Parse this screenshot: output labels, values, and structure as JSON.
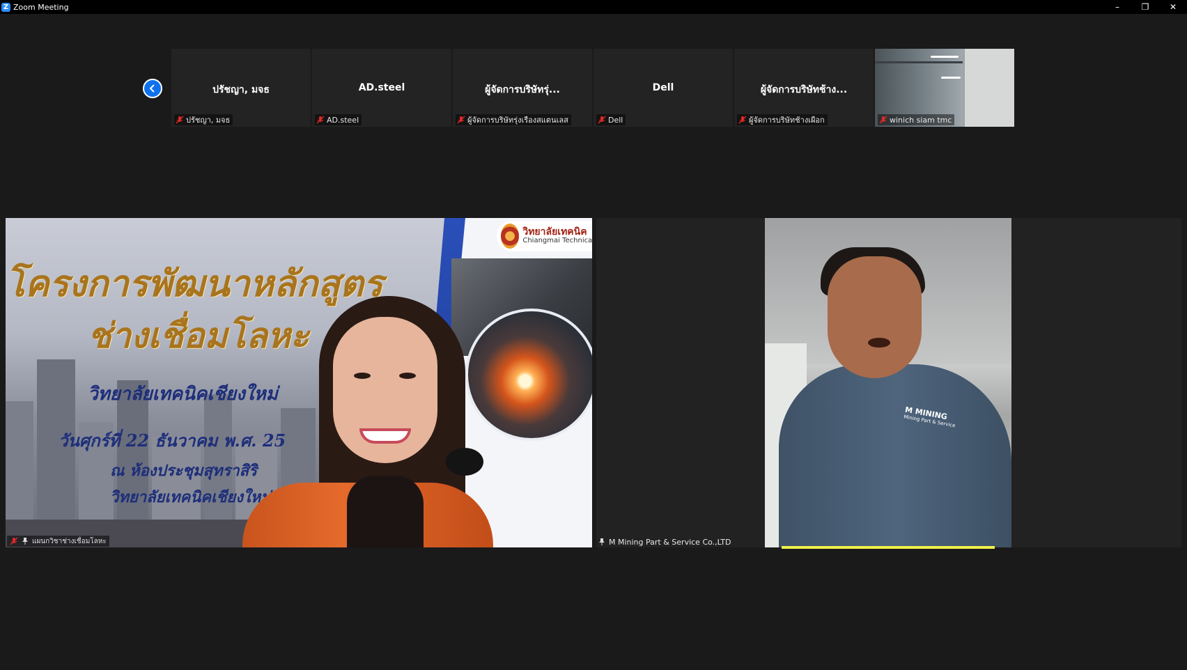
{
  "window": {
    "title": "Zoom Meeting",
    "logo_letter": "Z",
    "minimize": "–",
    "restore": "❐",
    "close": "✕"
  },
  "gallery": {
    "tiles": [
      {
        "center_name": "ปรัชญา, มจธ",
        "label": "ปรัชญา, มจธ"
      },
      {
        "center_name": "AD.steel",
        "label": "AD.steel"
      },
      {
        "center_name": "ผู้จัดการบริษัทรุ่...",
        "label": "ผู้จัดการบริษัทรุ่งเรืองสแตนเลส"
      },
      {
        "center_name": "Dell",
        "label": "Dell"
      },
      {
        "center_name": "ผู้จัดการบริษัทช้าง...",
        "label": "ผู้จัดการบริษัทช้างเผือก"
      },
      {
        "center_name": "",
        "label": "winich siam tmc"
      }
    ]
  },
  "main_video": {
    "label": "แผนกวิชาช่างเชื่อมโลหะ",
    "slide": {
      "logo_th": "วิทยาลัยเทคนิค",
      "logo_en": "Chiangmai Technical",
      "title_line1": "โครงการพัฒนาหลักสูตร",
      "title_line2": "ช่างเชื่อมโลหะ",
      "college": "วิทยาลัยเทคนิคเชียงใหม่",
      "date": "วันศุกร์ที่ 22 ธันวาคม พ.ศ. 25",
      "venue": "ณ ห้องประชุมสุทราสิริ",
      "venue2": "วิทยาลัยเทคนิคเชียงใหม่"
    }
  },
  "second_video": {
    "label": "M Mining Part & Service Co.,LTD",
    "shirt_logo": "M MINING",
    "shirt_logo_sub": "Mining Part & Service"
  },
  "colors": {
    "accent": "#2D8CFF",
    "nav_button": "#0e72ed",
    "mic_muted": "#e02828",
    "speaking": "#f0f04a"
  }
}
